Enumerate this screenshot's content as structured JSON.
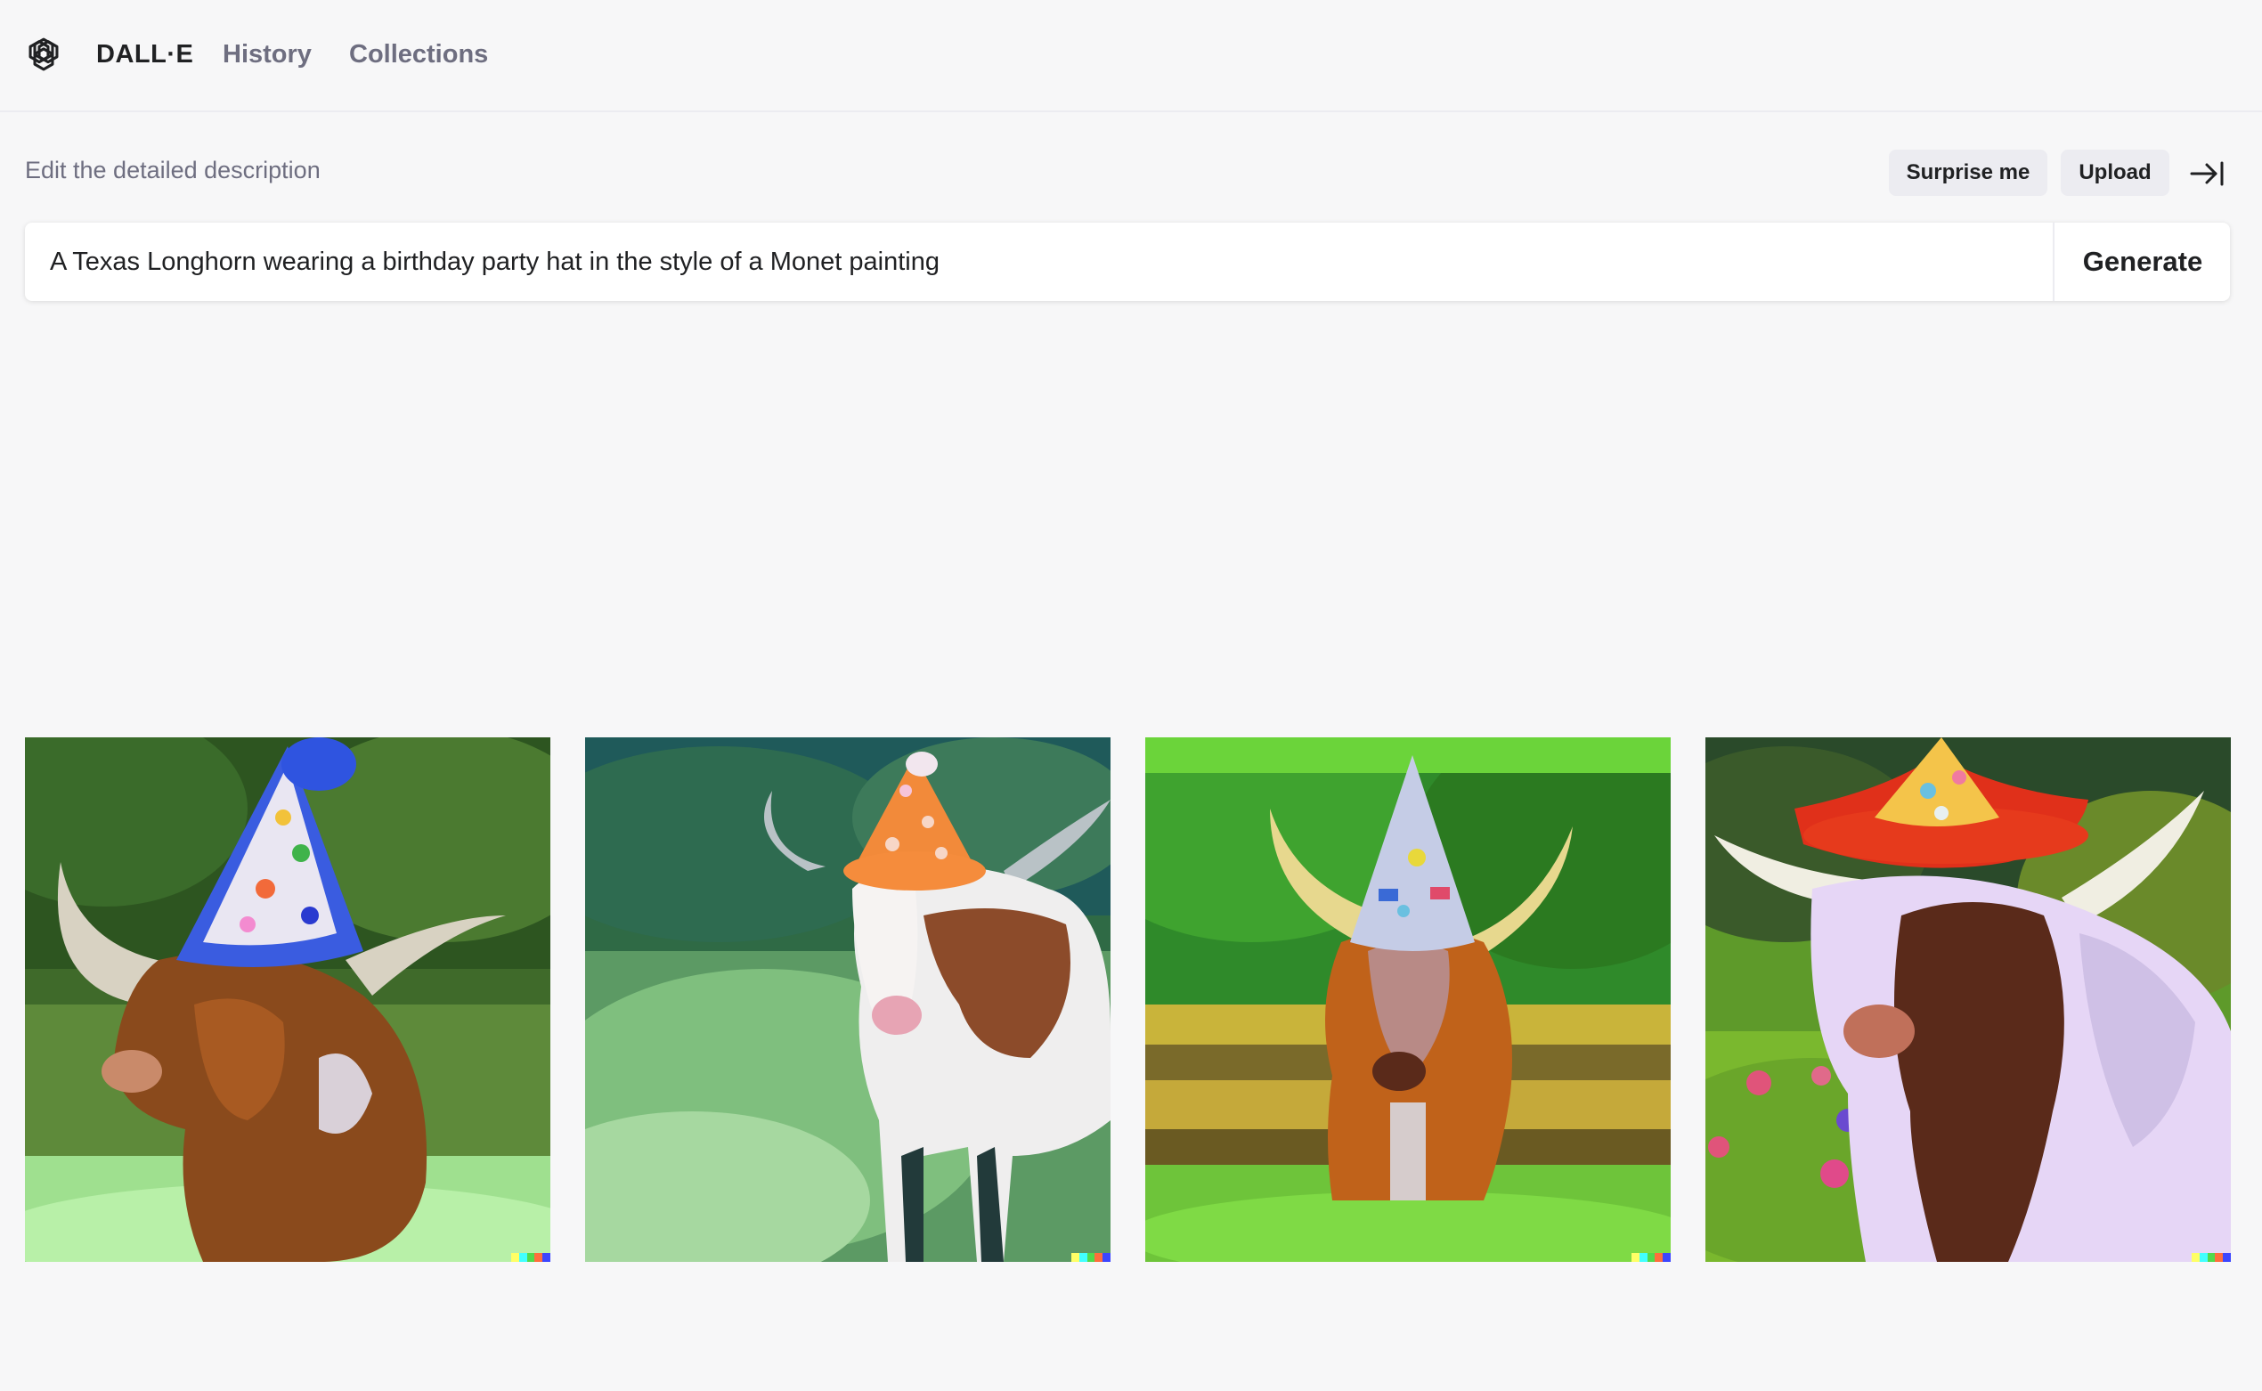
{
  "header": {
    "logo_icon": "openai-logo-icon",
    "brand": "DALL·E",
    "nav": [
      "History",
      "Collections"
    ]
  },
  "editor": {
    "label": "Edit the detailed description",
    "surprise_label": "Surprise me",
    "upload_label": "Upload",
    "collapse_icon": "collapse-panel-icon",
    "prompt_value": "A Texas Longhorn wearing a birthday party hat in the style of a Monet painting",
    "generate_label": "Generate"
  },
  "results": {
    "count": 4,
    "watermark_colors": [
      "#ffff66",
      "#42ffff",
      "#51da4c",
      "#ff6e3c",
      "#3c46ff"
    ]
  }
}
